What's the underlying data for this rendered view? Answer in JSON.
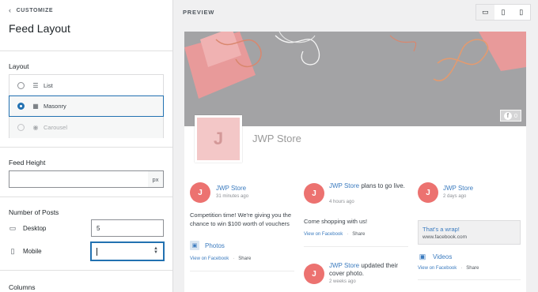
{
  "sidebar": {
    "back_label": "CUSTOMIZE",
    "title": "Feed Layout",
    "layout": {
      "label": "Layout",
      "options": [
        {
          "label": "List",
          "icon": "list-icon",
          "selected": false,
          "disabled": false
        },
        {
          "label": "Masonry",
          "icon": "masonry-icon",
          "selected": true,
          "disabled": false
        },
        {
          "label": "Carousel",
          "icon": "carousel-icon",
          "selected": false,
          "disabled": true
        }
      ]
    },
    "feed_height": {
      "label": "Feed Height",
      "value": "",
      "suffix": "px"
    },
    "num_posts": {
      "label": "Number of Posts",
      "desktop_label": "Desktop",
      "desktop_value": "5",
      "mobile_label": "Mobile",
      "mobile_value": ""
    },
    "columns_label": "Columns"
  },
  "main": {
    "preview_label": "PREVIEW",
    "devices": [
      "desktop-icon",
      "tablet-icon",
      "mobile-icon"
    ],
    "active_device": "desktop",
    "header": {
      "store_name": "JWP Store",
      "avatar_letter": "J",
      "likes_count": "0"
    },
    "posts": [
      {
        "author": "JWP Store",
        "action": "",
        "time": "31 minutes ago",
        "text": "Competition time! We're giving you the chance to win $100 worth of vouchers",
        "media_label": "Photos",
        "view_label": "View on Facebook",
        "share_label": "Share"
      },
      {
        "author": "JWP Store",
        "action": " plans to go live.",
        "time": "4 hours ago",
        "text": "Come shopping with us!",
        "view_label": "View on Facebook",
        "share_label": "Share"
      },
      {
        "author": "JWP Store",
        "action": "",
        "time": "2 days ago",
        "link_title": "That's a wrap!",
        "link_url": "www.facebook.com",
        "media_label": "Videos",
        "view_label": "View on Facebook",
        "share_label": "Share"
      },
      {
        "author": "JWP Store",
        "action": " updated their cover photo.",
        "time": "2 weeks ago"
      }
    ]
  },
  "colors": {
    "accent": "#2271b1",
    "link": "#3b7bbf",
    "avatar": "#ec7270",
    "cover": "#a3a3a5"
  }
}
